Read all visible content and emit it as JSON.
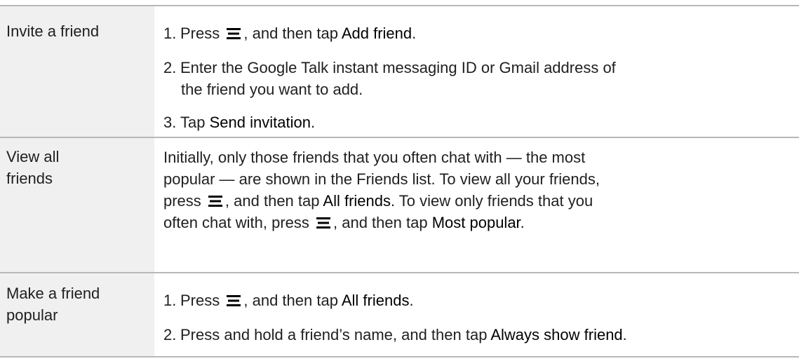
{
  "rows": [
    {
      "label": "Invite a friend",
      "steps": [
        {
          "num": "1.",
          "pre": "Press",
          "mid": ", and then tap",
          "ui": "Add friend",
          "post": "."
        },
        {
          "num": "2.",
          "text_line1": "Enter the Google Talk instant messaging ID or Gmail address of",
          "text_line2": "the friend you want to add."
        },
        {
          "num": "3.",
          "pre": "Tap",
          "ui": "Send invitation",
          "post": "."
        }
      ]
    },
    {
      "label_line1": "View all",
      "label_line2": "friends",
      "line1": "Initially, only those friends that you often chat with — the most",
      "line2": "popular — are shown in the Friends list. To view all your friends,",
      "line3_pre": "press",
      "line3_mid": ", and then tap",
      "line3_ui": "All friends",
      "line3_post": ". To view only friends that you",
      "line4_pre": "often chat with, press",
      "line4_mid": ", and then tap",
      "line4_ui": "Most popular",
      "line4_post": "."
    },
    {
      "label_line1": "Make a friend",
      "label_line2": "popular",
      "steps": [
        {
          "num": "1.",
          "pre": "Press",
          "mid": ", and then tap",
          "ui": "All friends",
          "post": "."
        },
        {
          "num": "2.",
          "pre": "Press and hold a friend’s name, and then tap",
          "ui": "Always show friend",
          "post": "."
        }
      ]
    }
  ],
  "icons": {
    "menu": "menu-icon"
  }
}
